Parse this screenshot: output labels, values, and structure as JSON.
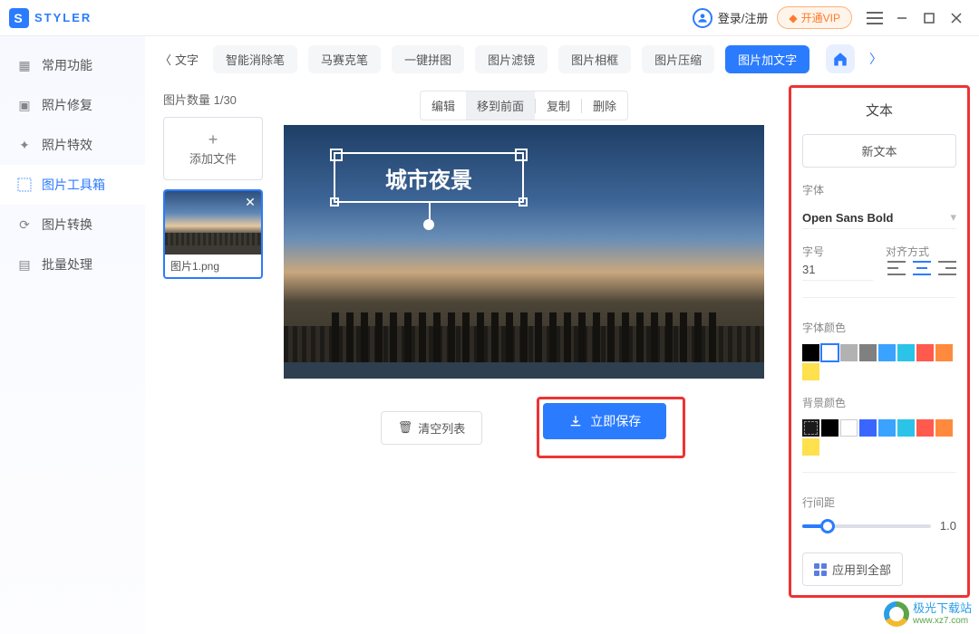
{
  "app": {
    "name": "STYLER",
    "logoLetter": "S"
  },
  "titlebar": {
    "login": "登录/注册",
    "vip": "开通VIP"
  },
  "sidebar": {
    "items": [
      {
        "label": "常用功能"
      },
      {
        "label": "照片修复"
      },
      {
        "label": "照片特效"
      },
      {
        "label": "图片工具箱"
      },
      {
        "label": "图片转换"
      },
      {
        "label": "批量处理"
      }
    ],
    "activeIndex": 3
  },
  "toolrow": {
    "back": "文字",
    "chips": [
      "智能消除笔",
      "马赛克笔",
      "一键拼图",
      "图片滤镜",
      "图片相框",
      "图片压缩",
      "图片加文字"
    ],
    "activeChip": 6
  },
  "filelist": {
    "countLabel": "图片数量 1/30",
    "addLabel": "添加文件",
    "thumbName": "图片1.png"
  },
  "contextToolbar": {
    "items": [
      "编辑",
      "移到前面",
      "复制",
      "删除"
    ],
    "active": 1
  },
  "textbox": {
    "value": "城市夜景"
  },
  "bottom": {
    "clear": "清空列表",
    "save": "立即保存"
  },
  "panel": {
    "title": "文本",
    "newText": "新文本",
    "fontLabel": "字体",
    "fontValue": "Open Sans Bold",
    "sizeLabel": "字号",
    "sizeValue": "31",
    "alignLabel": "对齐方式",
    "fontColorLabel": "字体颜色",
    "fontColors": [
      "#000000",
      "#ffffff",
      "#b2b2b2",
      "#808080",
      "#3aa3ff",
      "#2bc3e8",
      "#ff5a4d",
      "#ff8a3d",
      "#ffe04d"
    ],
    "fontColorSelected": 1,
    "bgColorLabel": "背景颜色",
    "bgColors": [
      "dashed",
      "#000000",
      "white",
      "#3a66ff",
      "#3aa3ff",
      "#2bc3e8",
      "#ff5a4d",
      "#ff8a3d",
      "#ffe04d"
    ],
    "bgColorSelected": 0,
    "lineSpacingLabel": "行间距",
    "lineSpacingValue": "1.0",
    "applyAll": "应用到全部"
  },
  "watermark": {
    "cn": "极光下载站",
    "url": "www.xz7.com"
  }
}
